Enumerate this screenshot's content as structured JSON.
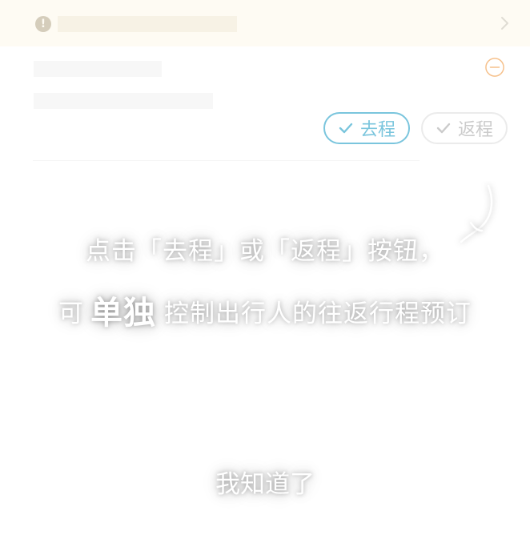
{
  "notice": {
    "icon": "exclamation-circle-icon",
    "icon_glyph": "!",
    "chevron_icon": "chevron-right-icon"
  },
  "passenger_card": {
    "remove_icon": "minus-circle-icon",
    "outbound_label": "去程",
    "return_label": "返程",
    "outbound_selected": true,
    "return_selected": false,
    "check_icon": "check-icon"
  },
  "guide": {
    "line1": "点击「去程」或「返程」按钮，",
    "line2_prefix": "可",
    "line2_emphasis": "单独",
    "line2_suffix": "控制出行人的往返行程预订",
    "dismiss_label": "我知道了",
    "arrow_icon": "curved-arrow-icon"
  },
  "colors": {
    "notice_bg": "#fdf8ea",
    "primary": "#1a9cc4",
    "remove": "#f0953a",
    "inactive": "#a5a5a5"
  }
}
